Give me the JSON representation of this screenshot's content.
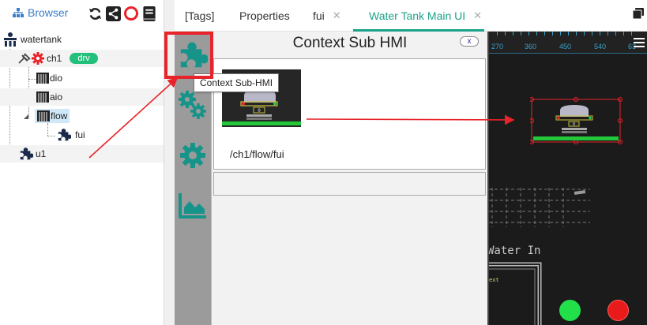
{
  "browser": {
    "title": "Browser",
    "tree": [
      {
        "label": "watertank"
      },
      {
        "label": "ch1",
        "badge": "drv"
      },
      {
        "label": "dio"
      },
      {
        "label": "aio"
      },
      {
        "label": "flow"
      },
      {
        "label": "fui"
      },
      {
        "label": "u1"
      }
    ]
  },
  "tabs": [
    {
      "label": "[Tags]"
    },
    {
      "label": "Properties"
    },
    {
      "label": "fui"
    },
    {
      "label": "Water Tank Main UI"
    }
  ],
  "dialog": {
    "title": "Context Sub HMI",
    "close": "x",
    "item_label": "/ch1/flow/fui",
    "tooltip": "Context Sub-HMI",
    "thumb_text": "0"
  },
  "canvas": {
    "ruler": [
      "270",
      "360",
      "450",
      "540",
      "63"
    ],
    "water_in": "Water In",
    "ext": "ext",
    "tank_text": "0"
  },
  "colors": {
    "accent": "#1aa38a",
    "highlight": "#e8232a",
    "badge": "#22c07a",
    "browser_title": "#3a7dc9",
    "lamp_green": "#22e04a",
    "lamp_red": "#e81a1a"
  }
}
